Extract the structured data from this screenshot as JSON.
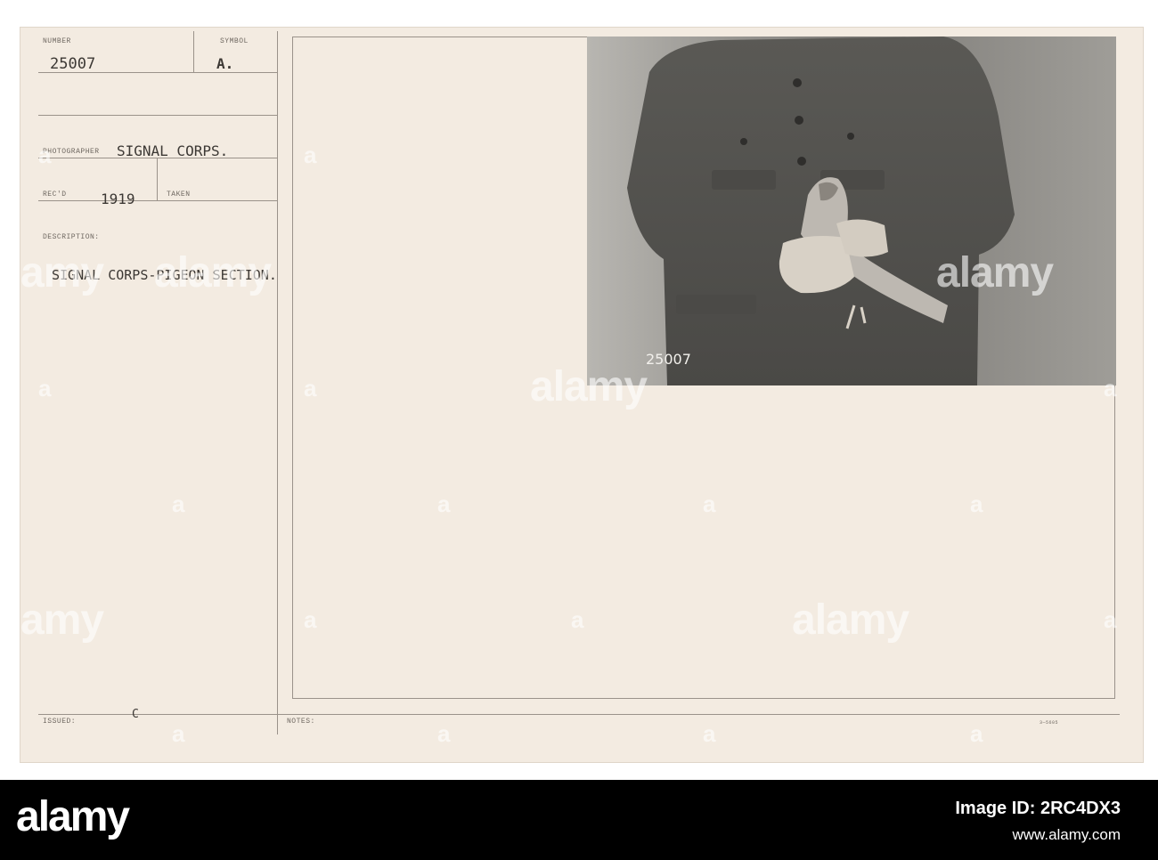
{
  "card": {
    "number_label": "NUMBER",
    "number_value": "25007",
    "symbol_label": "SYMBOL",
    "symbol_value": "A.",
    "photographer_label": "PHOTOGRAPHER",
    "photographer_value": "SIGNAL CORPS.",
    "recd_label": "REC'D",
    "recd_value": "1919",
    "taken_label": "TAKEN",
    "description_label": "DESCRIPTION:",
    "description_value": "SIGNAL CORPS-PIGEON SECTION.",
    "issued_label": "ISSUED:",
    "issued_value": "C",
    "notes_label": "NOTES:",
    "form_code": "3—5605"
  },
  "photo": {
    "negative_number": "25007",
    "subject": "soldier-holding-pigeon"
  },
  "watermark": {
    "text": "alamy",
    "glyph": "a"
  },
  "footer": {
    "logo_text": "alamy",
    "image_id": "Image ID: 2RC4DX3",
    "url": "www.alamy.com"
  },
  "colors": {
    "card_bg": "#f3ebe1",
    "footer_bg": "#000000",
    "ink": "#3c3834"
  }
}
